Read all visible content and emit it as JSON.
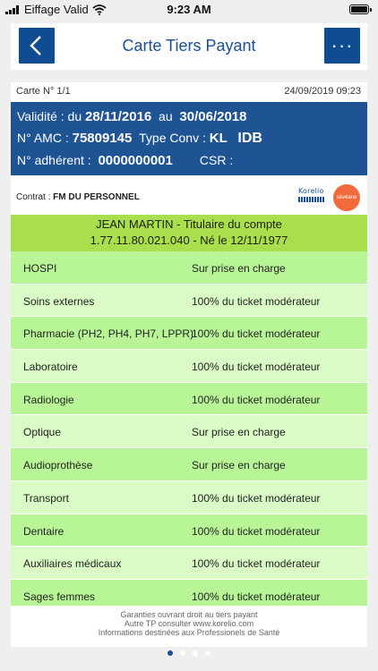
{
  "status_bar": {
    "carrier": "Eiffage Valid",
    "time": "9:23 AM",
    "signal_icon": "signal-bars-icon",
    "wifi_icon": "wifi-icon",
    "battery_icon": "battery-icon",
    "battery_level": 1.0
  },
  "nav": {
    "title": "Carte Tiers Payant",
    "back_icon": "chevron-left-icon",
    "more_label": "···",
    "accent": "#0f4c92"
  },
  "card": {
    "number": "Carte N° 1/1",
    "datetime": "24/09/2019 09:23",
    "validity_label": "Validité : du",
    "validity_from": "28/11/2016",
    "validity_to_label": "au",
    "validity_to": "30/06/2018",
    "amc_label": "N° AMC :",
    "amc_value": "75809145",
    "typeconv_label": "Type Conv :",
    "typeconv_value": "KL",
    "idb": "IDB",
    "adherent_label": "N° adhérent :",
    "adherent_value": "0000000001",
    "csr_label": "CSR :",
    "contract_label": "Contrat :",
    "contract_value": "FM DU PERSONNEL",
    "logo_korelio": "Korelio",
    "logo_seveane": "sévéane",
    "panel_color": "#1f5494"
  },
  "holder": {
    "line1": "JEAN MARTIN - Titulaire du compte",
    "line2": "1.77.11.80.021.040 - Né le 12/11/1977"
  },
  "coverage": [
    {
      "label": "HOSPI",
      "value": "Sur prise en charge"
    },
    {
      "label": "Soins externes",
      "value": "100% du ticket modérateur"
    },
    {
      "label": "Pharmacie (PH2, PH4, PH7, LPPR)",
      "value": "100% du ticket modérateur"
    },
    {
      "label": "Laboratoire",
      "value": "100% du ticket modérateur"
    },
    {
      "label": "Radiologie",
      "value": "100% du ticket modérateur"
    },
    {
      "label": "Optique",
      "value": "Sur prise en charge"
    },
    {
      "label": "Audioprothèse",
      "value": "Sur prise en charge"
    },
    {
      "label": "Transport",
      "value": "100% du ticket modérateur"
    },
    {
      "label": "Dentaire",
      "value": "100% du ticket modérateur"
    },
    {
      "label": "Auxiliaires médicaux",
      "value": "100% du ticket modérateur"
    },
    {
      "label": "Sages femmes",
      "value": "100% du ticket modérateur"
    }
  ],
  "footer": {
    "line1": "Garanties ouvrant droit au tiers payant",
    "line2": "Autre TP consulter www.korelio.com",
    "line3": "Informations destinées aux Professionels de Santé"
  },
  "pager": {
    "pages": 4,
    "current": 1
  }
}
